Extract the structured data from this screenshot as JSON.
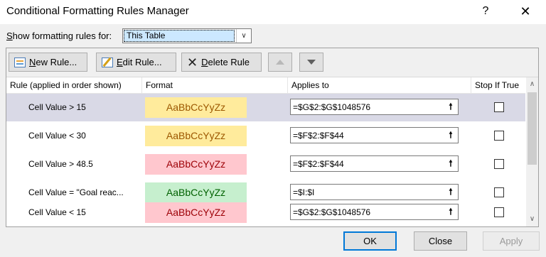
{
  "window": {
    "title": "Conditional Formatting Rules Manager",
    "help_glyph": "?",
    "close_glyph": "✕"
  },
  "show_rules": {
    "label_prefix": "",
    "label_access_key": "S",
    "label_rest": "how formatting rules for:",
    "selected_value": "This Table"
  },
  "toolbar": {
    "new_rule": {
      "access_key": "N",
      "rest": "ew Rule...",
      "icon": "new-rule-icon"
    },
    "edit_rule": {
      "access_key": "E",
      "rest": "dit Rule...",
      "icon": "edit-rule-icon"
    },
    "delete_rule": {
      "access_key": "D",
      "rest": "elete Rule",
      "icon": "delete-x-icon"
    },
    "move_up": {
      "icon": "triangle-up-icon",
      "enabled": false
    },
    "move_down": {
      "icon": "triangle-down-icon",
      "enabled": true
    }
  },
  "table": {
    "headers": {
      "rule": "Rule (applied in order shown)",
      "format": "Format",
      "applies_to": "Applies to",
      "stop_if_true": "Stop If True"
    },
    "rows": [
      {
        "rule": "Cell Value > 15",
        "sample": "AaBbCcYyZz",
        "sample_bg": "#ffeb9c",
        "sample_fg": "#9c5700",
        "applies_to": "=$G$2:$G$1048576",
        "stop_if_true": false,
        "selected": true
      },
      {
        "rule": "Cell Value < 30",
        "sample": "AaBbCcYyZz",
        "sample_bg": "#ffeb9c",
        "sample_fg": "#9c5700",
        "applies_to": "=$F$2:$F$44",
        "stop_if_true": false,
        "selected": false
      },
      {
        "rule": "Cell Value > 48.5",
        "sample": "AaBbCcYyZz",
        "sample_bg": "#ffc7ce",
        "sample_fg": "#9c0006",
        "applies_to": "=$F$2:$F$44",
        "stop_if_true": false,
        "selected": false
      },
      {
        "rule": "Cell Value = \"Goal reac...",
        "sample": "AaBbCcYyZz",
        "sample_bg": "#c6efce",
        "sample_fg": "#006100",
        "applies_to": "=$I:$I",
        "stop_if_true": false,
        "selected": false
      },
      {
        "rule": "Cell Value < 15",
        "sample": "AaBbCcYyZz",
        "sample_bg": "#ffc7ce",
        "sample_fg": "#9c0006",
        "applies_to": "=$G$2:$G$1048576",
        "stop_if_true": false,
        "selected": false
      }
    ],
    "collapse_glyph": "🠕",
    "scroll_up_glyph": "∧",
    "scroll_down_glyph": "∨"
  },
  "buttons": {
    "ok": "OK",
    "close": "Close",
    "apply": "Apply"
  }
}
